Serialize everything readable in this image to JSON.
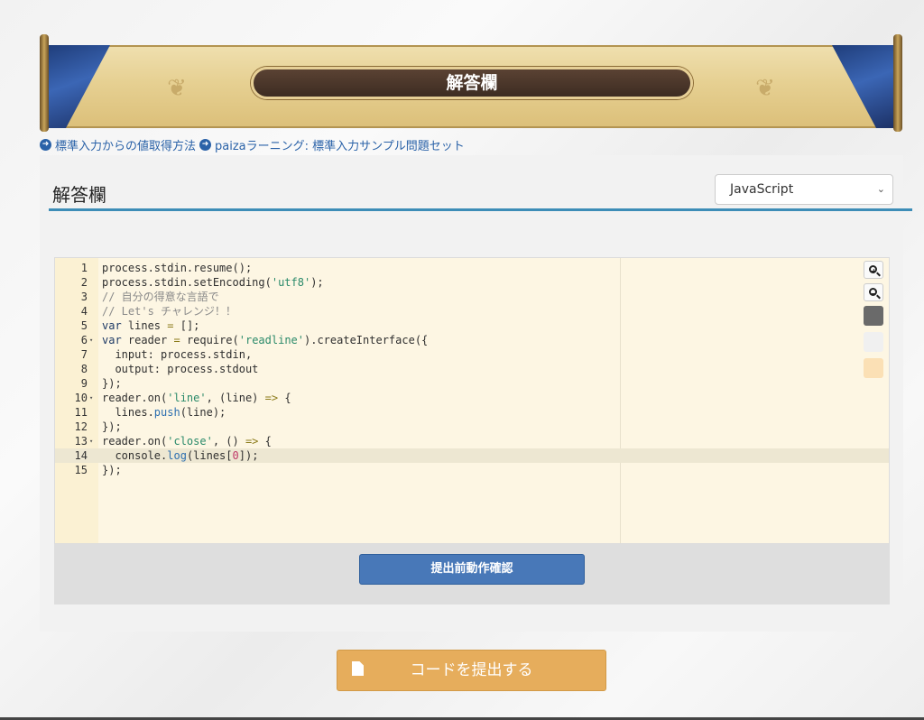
{
  "banner": {
    "title": "解答欄"
  },
  "links": [
    {
      "label": "標準入力からの値取得方法"
    },
    {
      "label": "paizaラーニング: 標準入力サンプル問題セット"
    }
  ],
  "panel": {
    "title": "解答欄",
    "language": "JavaScript"
  },
  "editor": {
    "lines": [
      {
        "num": "1",
        "fold": "",
        "html": "process.stdin.resume();"
      },
      {
        "num": "2",
        "fold": "",
        "html": "process.stdin.setEncoding(<span class=\"c-str\">'utf8'</span>);"
      },
      {
        "num": "3",
        "fold": "",
        "html": "<span class=\"c-cm\">// 自分の得意な言語で</span>"
      },
      {
        "num": "4",
        "fold": "",
        "html": "<span class=\"c-cm\">// Let's チャレンジ！！</span>"
      },
      {
        "num": "5",
        "fold": "",
        "html": "<span class=\"c-kw\">var</span> lines <span class=\"c-op\">=</span> [];"
      },
      {
        "num": "6",
        "fold": "▾",
        "html": "<span class=\"c-kw\">var</span> reader <span class=\"c-op\">=</span> require(<span class=\"c-str\">'readline'</span>).createInterface({"
      },
      {
        "num": "7",
        "fold": "",
        "html": "  input: process.stdin,"
      },
      {
        "num": "8",
        "fold": "",
        "html": "  output: process.stdout"
      },
      {
        "num": "9",
        "fold": "",
        "html": "});"
      },
      {
        "num": "10",
        "fold": "▾",
        "html": "reader.on(<span class=\"c-str\">'line'</span>, (line) <span class=\"c-op\">=&gt;</span> {"
      },
      {
        "num": "11",
        "fold": "",
        "html": "  lines.<span class=\"c-fn\">push</span>(line);"
      },
      {
        "num": "12",
        "fold": "",
        "html": "});"
      },
      {
        "num": "13",
        "fold": "▾",
        "html": "reader.on(<span class=\"c-str\">'close'</span>, () <span class=\"c-op\">=&gt;</span> {"
      },
      {
        "num": "14",
        "fold": "",
        "html": "  console.<span class=\"c-fn\">log</span>(lines[<span class=\"c-num\">0</span>]);"
      },
      {
        "num": "15",
        "fold": "",
        "html": "});"
      }
    ],
    "active_line": 14,
    "tools": {
      "zoom_in": "+",
      "zoom_out": "−"
    },
    "swatches": [
      "#6a6a6a",
      "#f0f0f0",
      "#fbe0b5"
    ]
  },
  "buttons": {
    "check": "提出前動作確認",
    "submit": "コードを提出する"
  }
}
